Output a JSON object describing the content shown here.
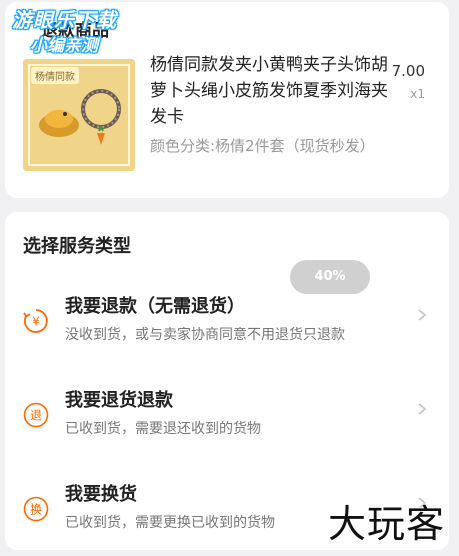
{
  "watermark": {
    "line1": "游眼乐下载",
    "line2": "小编亲测"
  },
  "product": {
    "section_title": "退款商品",
    "title": "杨倩同款发夹小黄鸭夹子头饰胡萝卜头绳小皮筋发饰夏季刘海夹发卡",
    "spec": "颜色分类:杨倩2件套（现货秒发）",
    "price": "7.00",
    "qty": "x1",
    "thumb_caption": "杨倩同款"
  },
  "service": {
    "heading": "选择服务类型",
    "progress": "40%",
    "options": [
      {
        "title": "我要退款（无需退货）",
        "desc": "没收到货，或与卖家协商同意不用退货只退款",
        "icon": "yen-return-icon"
      },
      {
        "title": "我要退货退款",
        "desc": "已收到货，需要退还收到的货物",
        "icon": "return-icon",
        "glyph": "退"
      },
      {
        "title": "我要换货",
        "desc": "已收到货，需要更换已收到的货物",
        "icon": "exchange-icon",
        "glyph": "换"
      }
    ]
  },
  "brand_watermark": "大玩客",
  "colors": {
    "accent": "#ff6a00",
    "background": "#f1f1f3",
    "card": "#ffffff"
  }
}
